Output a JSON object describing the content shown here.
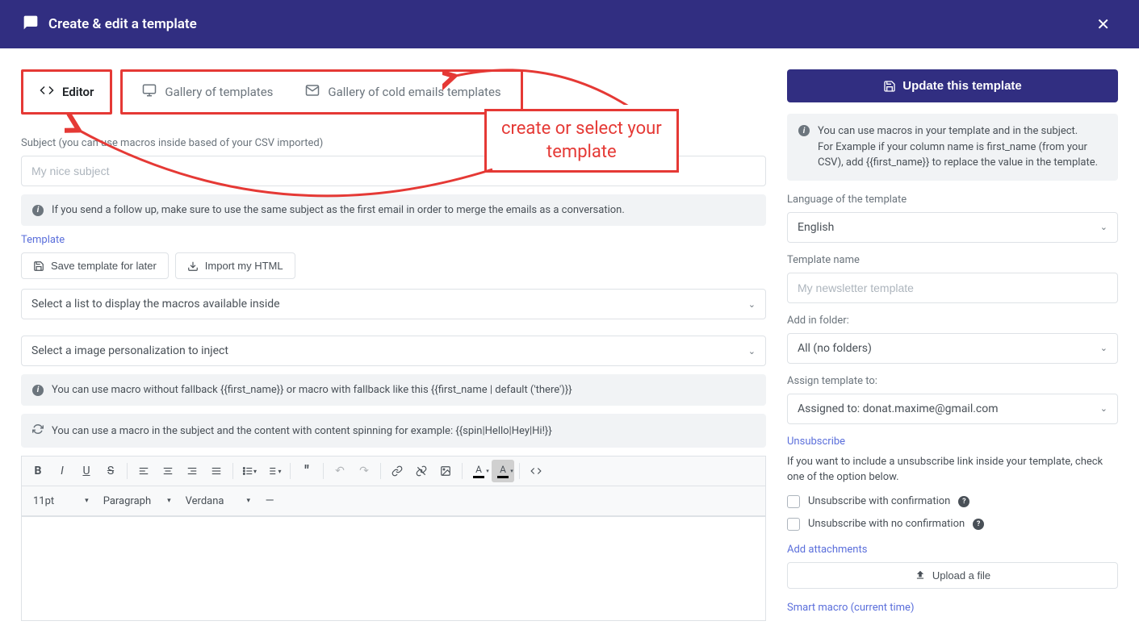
{
  "header": {
    "title": "Create & edit a template"
  },
  "tabs": {
    "editor": "Editor",
    "gallery": "Gallery of templates",
    "cold": "Gallery of cold emails templates"
  },
  "callout": {
    "line1": "create or select your",
    "line2": "template"
  },
  "main": {
    "subject_label": "Subject (you can use macros inside based of your CSV imported)",
    "subject_placeholder": "My nice subject",
    "followup_info": "If you send a follow up, make sure to use the same subject as the first email in order to merge the emails as a conversation.",
    "template_label": "Template",
    "save_btn": "Save template for later",
    "import_btn": "Import my HTML",
    "macro_list_select": "Select a list to display the macros available inside",
    "image_select": "Select a image personalization to inject",
    "macro_info": "You can use macro without fallback {{first_name}} or macro with fallback like this {{first_name | default ('there')}}",
    "spin_info": "You can use a macro in the subject and the content with content spinning for example: {{spin|Hello|Hey|Hi!}}",
    "toolbar": {
      "fontsize": "11pt",
      "para": "Paragraph",
      "font": "Verdana"
    }
  },
  "side": {
    "update_btn": "Update this template",
    "macro_info": "You can use macros in your template and in the subject.\nFor Example if your column name is first_name (from your CSV), add {{first_name}} to replace the value in the template.",
    "lang_label": "Language of the template",
    "lang_value": "English",
    "name_label": "Template name",
    "name_placeholder": "My newsletter template",
    "folder_label": "Add in folder:",
    "folder_value": "All (no folders)",
    "assign_label": "Assign template to:",
    "assign_value": "Assigned to: donat.maxime@gmail.com",
    "unsub_label": "Unsubscribe",
    "unsub_desc": "If you want to include a unsubscribe link inside your template, check one of the option below.",
    "unsub_confirm": "Unsubscribe with confirmation",
    "unsub_noconfirm": "Unsubscribe with no confirmation",
    "attach_label": "Add attachments",
    "upload_btn": "Upload a file",
    "smart_label": "Smart macro (current time)"
  }
}
